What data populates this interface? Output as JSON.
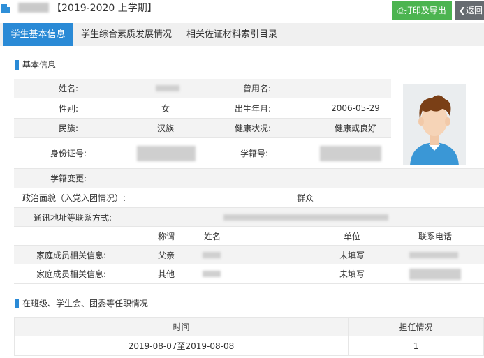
{
  "header": {
    "term_title": "【2019-2020 上学期】",
    "print_button": "⎙打印及导出",
    "back_button": "❮返回"
  },
  "tabs": [
    {
      "label": "学生基本信息",
      "active": true
    },
    {
      "label": "学生综合素质发展情况",
      "active": false
    },
    {
      "label": "相关佐证材料索引目录",
      "active": false
    }
  ],
  "basic_info": {
    "section_title": "基本信息",
    "name_label": "姓名:",
    "former_name_label": "曾用名:",
    "gender_label": "性别:",
    "gender_value": "女",
    "birth_label": "出生年月:",
    "birth_value": "2006-05-29",
    "ethnicity_label": "民族:",
    "ethnicity_value": "汉族",
    "health_label": "健康状况:",
    "health_value": "健康或良好",
    "id_label": "身份证号:",
    "student_no_label": "学籍号:",
    "enrollment_change_label": "学籍变更:",
    "political_label": "政治面貌（入党入团情况）:",
    "political_value": "群众",
    "address_label": "通讯地址等联系方式:",
    "family_headers": {
      "relation": "称谓",
      "name": "姓名",
      "unit": "单位",
      "phone": "联系电话"
    },
    "family_rows": [
      {
        "label": "家庭成员相关信息:",
        "relation": "父亲",
        "unit": "未填写"
      },
      {
        "label": "家庭成员相关信息:",
        "relation": "其他",
        "unit": "未填写"
      }
    ]
  },
  "positions": {
    "section_title": "在班级、学生会、团委等任职情况",
    "headers": {
      "time": "时间",
      "role": "担任情况"
    },
    "rows": [
      {
        "time": "2019-08-07至2019-08-08",
        "role": "1"
      }
    ]
  },
  "colors": {
    "accent": "#2a8ad6",
    "print_green": "#4cb450",
    "back_gray": "#666b70"
  }
}
